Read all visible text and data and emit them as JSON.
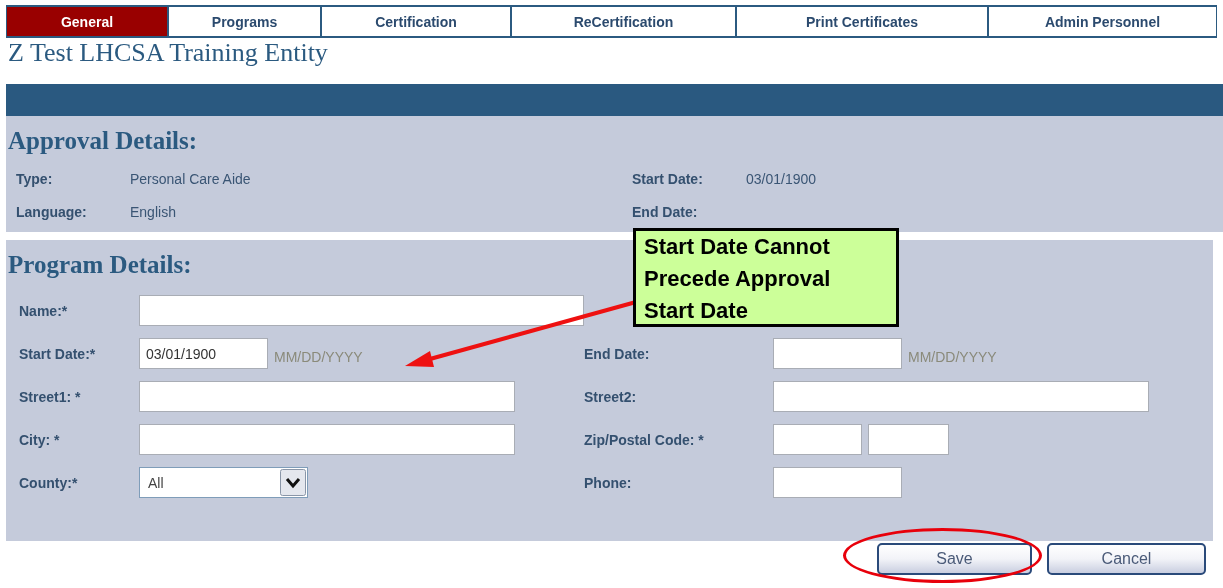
{
  "tabs": [
    {
      "label": "General",
      "selected": true
    },
    {
      "label": "Programs",
      "selected": false
    },
    {
      "label": "Certification",
      "selected": false
    },
    {
      "label": "ReCertification",
      "selected": false
    },
    {
      "label": "Print Certificates",
      "selected": false
    },
    {
      "label": "Admin Personnel",
      "selected": false
    }
  ],
  "entity_title": "Z Test LHCSA Training Entity",
  "approval": {
    "heading": "Approval Details:",
    "rows": [
      [
        {
          "label": "Type:",
          "value": "Personal Care Aide"
        },
        {
          "label": "Start Date:",
          "value": "03/01/1900"
        }
      ],
      [
        {
          "label": "Language:",
          "value": "English"
        },
        {
          "label": "End Date:"
        }
      ]
    ]
  },
  "program": {
    "heading": "Program Details:",
    "rows": [
      [
        {
          "label": "Name:*",
          "kind": "name"
        }
      ],
      [
        {
          "label": "Start Date:*",
          "kind": "date",
          "value": "03/01/1900",
          "hint": "MM/DD/YYYY"
        },
        {
          "label": "End Date:",
          "kind": "date",
          "hint": "MM/DD/YYYY"
        }
      ],
      [
        {
          "label": "Street1: *",
          "kind": "address"
        },
        {
          "label": "Street2:",
          "kind": "address"
        }
      ],
      [
        {
          "label": "City: *",
          "kind": "address"
        },
        {
          "label": "Zip/Postal Code: *",
          "kind": "zip"
        }
      ],
      [
        {
          "label": "County:*",
          "kind": "select",
          "value": "All"
        },
        {
          "label": "Phone:",
          "kind": "phone"
        }
      ]
    ]
  },
  "callout": "Start Date Cannot\nPrecede Approval\nStart Date",
  "buttons": [
    {
      "label": "Save",
      "highlighted": true
    },
    {
      "label": "Cancel",
      "highlighted": false
    }
  ]
}
